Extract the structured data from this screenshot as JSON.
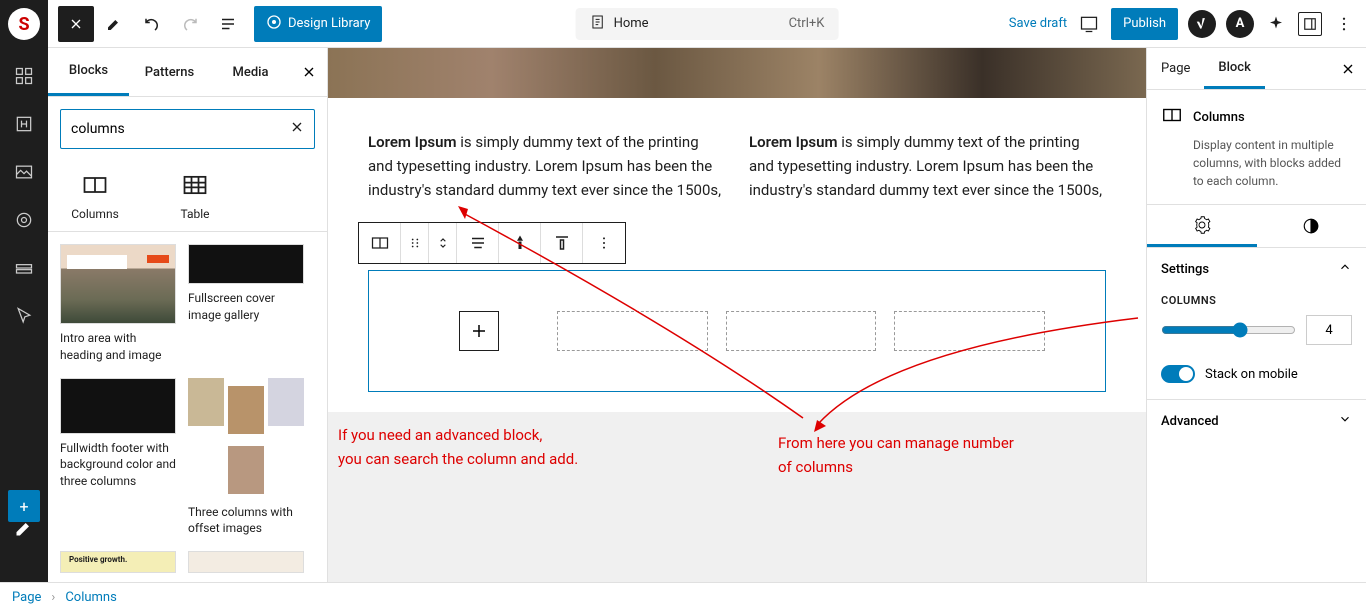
{
  "left_rail": {
    "plus": "+"
  },
  "top_bar": {
    "design_library": "Design Library",
    "page_name": "Home",
    "shortcut": "Ctrl+K",
    "save_draft": "Save draft",
    "publish": "Publish"
  },
  "inserter": {
    "tabs": {
      "blocks": "Blocks",
      "patterns": "Patterns",
      "media": "Media"
    },
    "search_value": "columns",
    "blocks": {
      "columns": "Columns",
      "table": "Table"
    },
    "patterns": {
      "intro_area": "Intro area with heading and image",
      "fullscreen_cover": "Fullscreen cover image gallery",
      "fullwidth_footer": "Fullwidth footer with background color and three columns",
      "three_col_offset": "Three columns with offset images",
      "positive_growth": "Positive growth."
    }
  },
  "canvas": {
    "para_bold": "Lorem Ipsum",
    "para_text": " is simply dummy text of the printing and typesetting industry. Lorem Ipsum has been the industry's standard dummy text ever since the 1500s,",
    "anno1_l1": "If you need an advanced block,",
    "anno1_l2": "you can search the column and add.",
    "anno2_l1": "From here you can manage number",
    "anno2_l2": "of columns"
  },
  "right_sb": {
    "tabs": {
      "page": "Page",
      "block": "Block"
    },
    "block_title": "Columns",
    "block_desc": "Display content in multiple columns, with blocks added to each column.",
    "settings": "Settings",
    "columns_label": "COLUMNS",
    "columns_value": "4",
    "stack_mobile": "Stack on mobile",
    "advanced": "Advanced"
  },
  "footer": {
    "page": "Page",
    "columns": "Columns"
  }
}
